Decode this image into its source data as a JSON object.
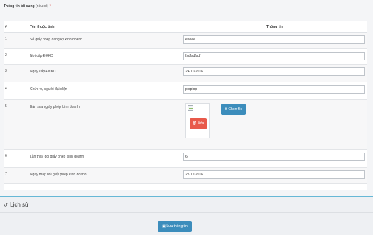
{
  "section": {
    "title": "Thông tin bổ sung",
    "note": "(nếu có)",
    "required_mark": "*"
  },
  "table": {
    "headers": {
      "no": "#",
      "name": "Tên thuộc tính",
      "info": "Thông tin"
    },
    "rows": [
      {
        "no": "1",
        "name": "Số giấy phép đăng ký kinh doanh",
        "value": "eeeee"
      },
      {
        "no": "2",
        "name": "Nơi cấp ĐKKD",
        "value": "fsdfsdfsdf"
      },
      {
        "no": "3",
        "name": "Ngày cấp ĐKKD",
        "value": "24/10/2016"
      },
      {
        "no": "4",
        "name": "Chức vụ người đại diện",
        "value": "piopiop"
      },
      {
        "no": "5",
        "name": "Bản scan giấy phép kinh doanh",
        "delete_label": "Xóa",
        "choose_label": "Chọn file"
      },
      {
        "no": "6",
        "name": "Lần thay đổi giấy phép kinh doanh",
        "value": "6"
      },
      {
        "no": "7",
        "name": "Ngày thay đổi giấy phép kinh doanh",
        "value": "27/12/2016"
      }
    ]
  },
  "history": {
    "title": "Lịch sử",
    "icon": "history-icon"
  },
  "actions": {
    "save_label": "Lưu thông tin",
    "save_icon": "save-icon"
  },
  "colors": {
    "primary": "#3c8dbc",
    "danger": "#e8594a",
    "divider": "#67b8d6"
  }
}
